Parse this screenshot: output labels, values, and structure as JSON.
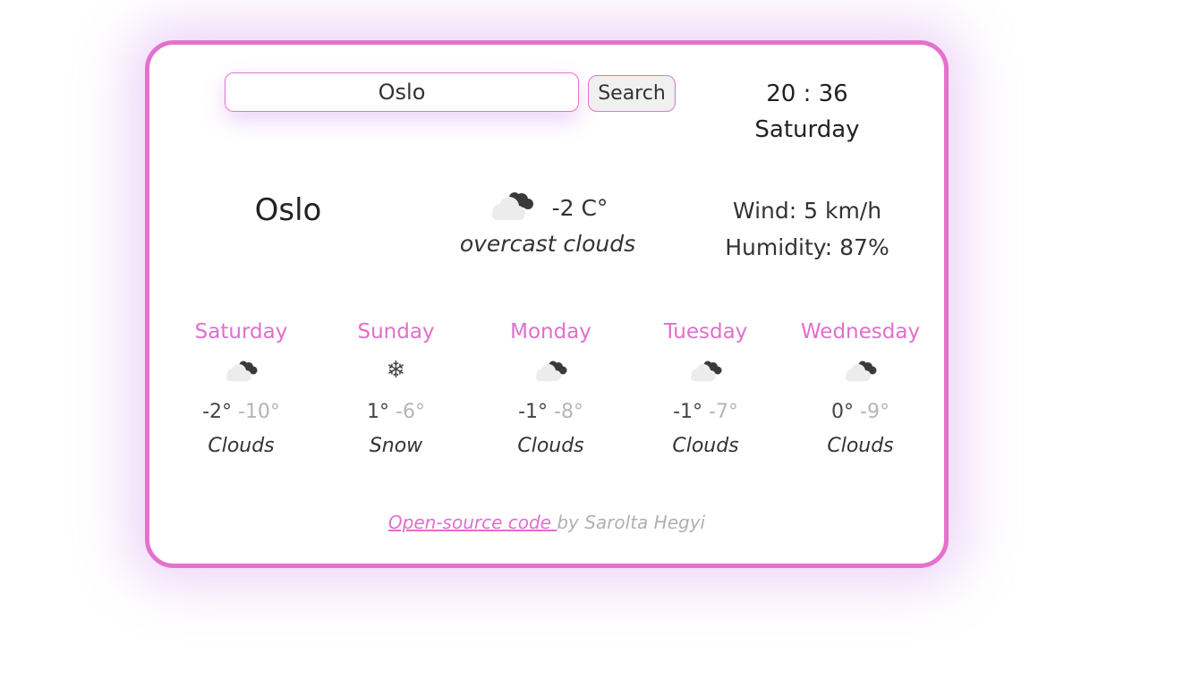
{
  "search": {
    "value": "Oslo",
    "button_label": "Search"
  },
  "clock": {
    "time": "20 : 36",
    "day": "Saturday"
  },
  "current": {
    "city": "Oslo",
    "temperature": "-2 C°",
    "description": "overcast clouds",
    "icon": "overcast-clouds-icon",
    "wind": "Wind: 5 km/h",
    "humidity": "Humidity: 87%"
  },
  "forecast": [
    {
      "day": "Saturday",
      "max": "-2°",
      "min": "-10°",
      "condition": "Clouds",
      "icon": "clouds-icon"
    },
    {
      "day": "Sunday",
      "max": "1°",
      "min": "-6°",
      "condition": "Snow",
      "icon": "snowflake-icon"
    },
    {
      "day": "Monday",
      "max": "-1°",
      "min": "-8°",
      "condition": "Clouds",
      "icon": "clouds-icon"
    },
    {
      "day": "Tuesday",
      "max": "-1°",
      "min": "-7°",
      "condition": "Clouds",
      "icon": "clouds-icon"
    },
    {
      "day": "Wednesday",
      "max": "0°",
      "min": "-9°",
      "condition": "Clouds",
      "icon": "clouds-icon"
    }
  ],
  "footer": {
    "link_text": "Open-source code ",
    "author_text": "by Sarolta Hegyi"
  },
  "colors": {
    "accent": "#e472cc",
    "day_label": "#e06fcc",
    "min_temp": "#b5b5b5",
    "glow": "#d6a0f0"
  }
}
